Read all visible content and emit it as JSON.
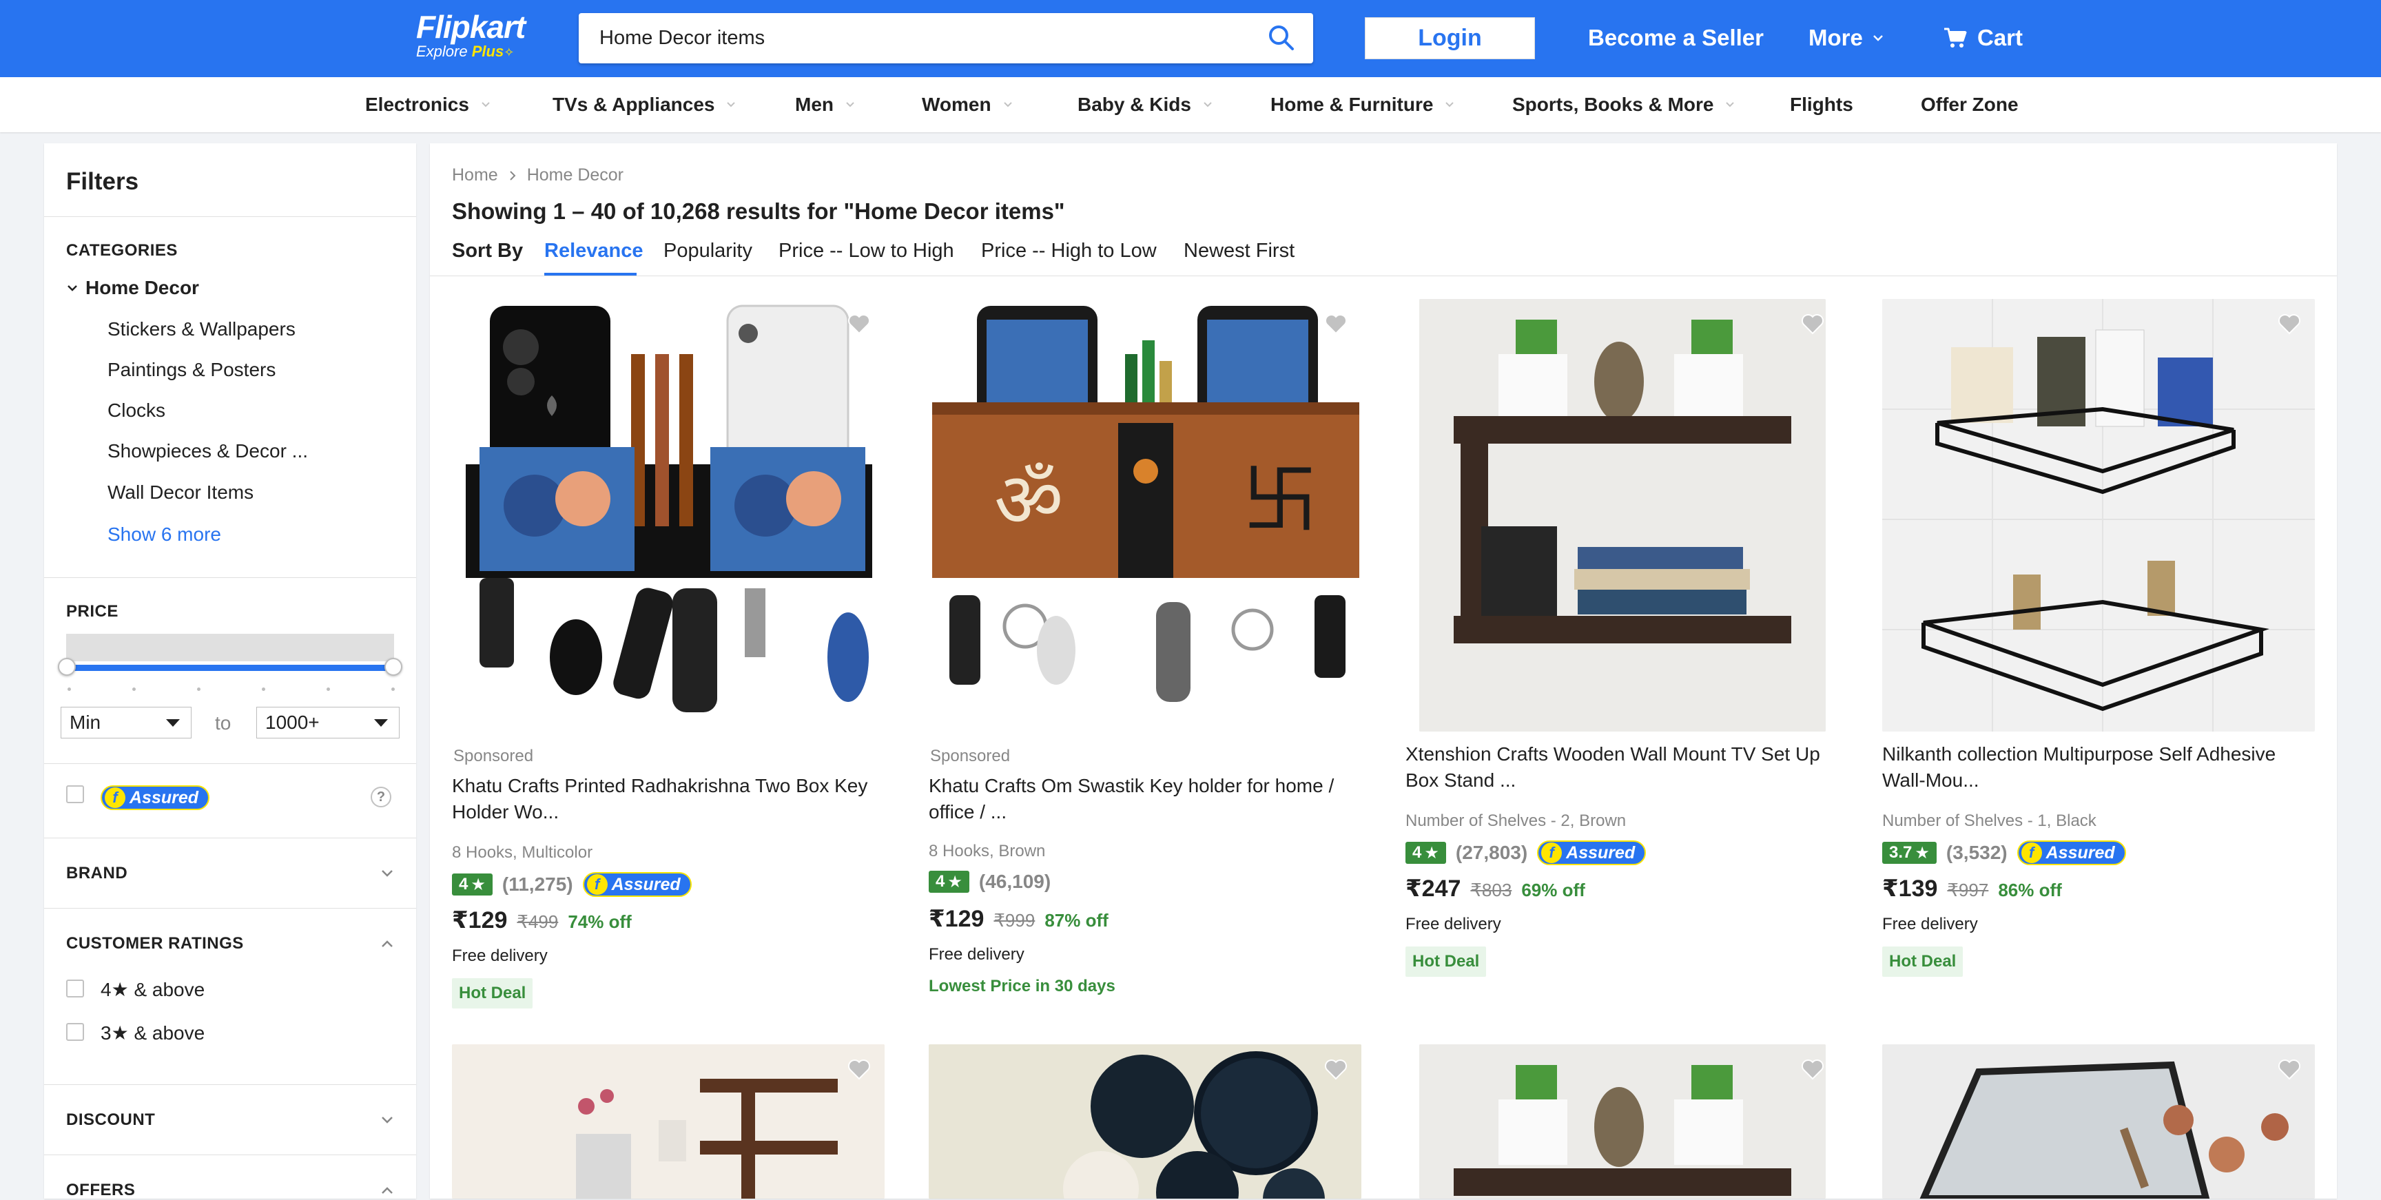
{
  "header": {
    "logo_main": "Flipkart",
    "logo_sub_prefix": "Explore",
    "logo_sub_plus": "Plus",
    "search_value": "Home Decor items",
    "login_label": "Login",
    "seller_label": "Become a Seller",
    "more_label": "More",
    "cart_label": "Cart",
    "brand_color": "#2874f0"
  },
  "nav": {
    "items": [
      {
        "label": "Electronics",
        "has_chevron": true
      },
      {
        "label": "TVs & Appliances",
        "has_chevron": true
      },
      {
        "label": "Men",
        "has_chevron": true
      },
      {
        "label": "Women",
        "has_chevron": true
      },
      {
        "label": "Baby & Kids",
        "has_chevron": true
      },
      {
        "label": "Home & Furniture",
        "has_chevron": true
      },
      {
        "label": "Sports, Books & More",
        "has_chevron": true
      },
      {
        "label": "Flights",
        "has_chevron": false
      },
      {
        "label": "Offer Zone",
        "has_chevron": false
      }
    ]
  },
  "filters": {
    "title": "Filters",
    "categories_heading": "CATEGORIES",
    "category_root": "Home Decor",
    "category_items": [
      "Stickers & Wallpapers",
      "Paintings & Posters",
      "Clocks",
      "Showpieces & Decor ...",
      "Wall Decor Items"
    ],
    "show_more": "Show 6 more",
    "price_heading": "PRICE",
    "price_min": "Min",
    "price_to": "to",
    "price_max": "1000+",
    "assured_label": "Assured",
    "help_icon": "?",
    "brand_heading": "BRAND",
    "ratings_heading": "CUSTOMER RATINGS",
    "rating_options": [
      "4★ & above",
      "3★ & above"
    ],
    "discount_heading": "DISCOUNT",
    "offers_heading": "OFFERS"
  },
  "main": {
    "breadcrumb": [
      "Home",
      "Home Decor"
    ],
    "results_text": "Showing 1 – 40 of 10,268 results for \"Home Decor items\"",
    "sort_by_label": "Sort By",
    "sort_options": [
      "Relevance",
      "Popularity",
      "Price -- Low to High",
      "Price -- High to Low",
      "Newest First"
    ],
    "sort_active": "Relevance"
  },
  "products": [
    {
      "sponsored": "Sponsored",
      "title_line1": "Khatu Crafts Printed Radhakrishna Two Box Key",
      "title_line2": "Holder Wo...",
      "subtitle": "8 Hooks, Multicolor",
      "rating": "4",
      "rating_count": "(11,275)",
      "assured": "Assured",
      "price": "₹129",
      "mrp": "₹499",
      "discount": "74% off",
      "delivery": "Free delivery",
      "deal": "Hot Deal"
    },
    {
      "sponsored": "Sponsored",
      "title_line1": "Khatu Crafts Om Swastik Key holder for home /",
      "title_line2": "office / ...",
      "subtitle": "8 Hooks, Brown",
      "rating": "4",
      "rating_count": "(46,109)",
      "price": "₹129",
      "mrp": "₹999",
      "discount": "87% off",
      "delivery": "Free delivery",
      "lowest_price": "Lowest Price in 30 days"
    },
    {
      "title_line1": "Xtenshion Crafts Wooden Wall Mount TV Set Up",
      "title_line2": "Box Stand ...",
      "subtitle": "Number of Shelves - 2, Brown",
      "rating": "4",
      "rating_count": "(27,803)",
      "assured": "Assured",
      "price": "₹247",
      "mrp": "₹803",
      "discount": "69% off",
      "delivery": "Free delivery",
      "deal": "Hot Deal"
    },
    {
      "title_line1": "Nilkanth collection Multipurpose Self Adhesive",
      "title_line2": "Wall-Mou...",
      "subtitle": "Number of Shelves - 1, Black",
      "rating": "3.7",
      "rating_count": "(3,532)",
      "assured": "Assured",
      "price": "₹139",
      "mrp": "₹997",
      "discount": "86% off",
      "delivery": "Free delivery",
      "deal": "Hot Deal"
    }
  ],
  "icons": {
    "search": "search-icon",
    "cart": "cart-icon",
    "heart": "heart-icon",
    "star": "star-icon",
    "chevron": "chevron-down-icon"
  }
}
